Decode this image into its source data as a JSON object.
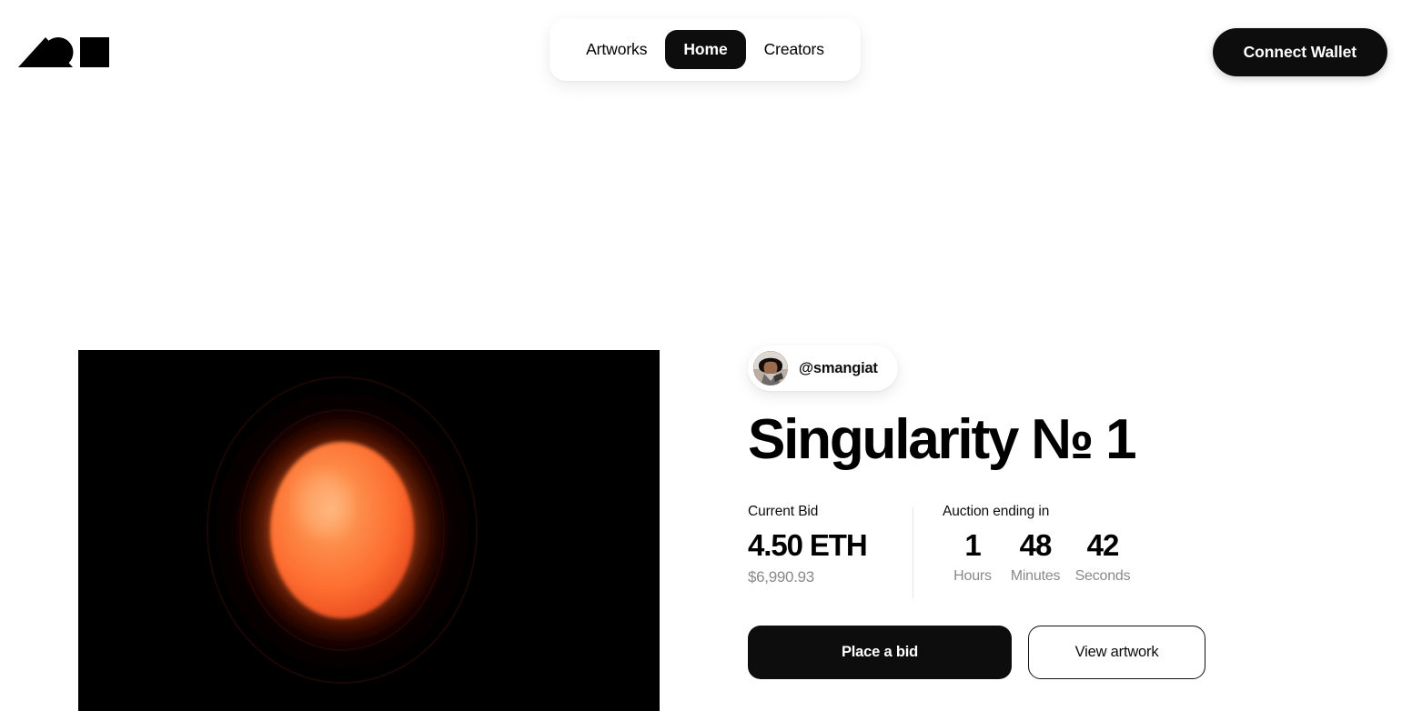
{
  "header": {
    "logo": {
      "name": "brand-logo",
      "shapes": [
        "triangle",
        "circle",
        "square"
      ],
      "color": "#000000"
    },
    "nav": {
      "items": [
        {
          "label": "Artworks",
          "active": false
        },
        {
          "label": "Home",
          "active": true
        },
        {
          "label": "Creators",
          "active": false
        }
      ]
    },
    "connect_wallet_label": "Connect Wallet"
  },
  "hero": {
    "artwork": {
      "alt": "Glowing orange sphere on black background",
      "background_color": "#000000",
      "core_color": "#ff6a33",
      "core_highlight": "#ffa05c",
      "halo_color": "#3a1109"
    },
    "artist": {
      "handle": "@smangiat",
      "avatar_name": "artist-avatar"
    },
    "title": "Singularity № 1",
    "bid": {
      "label": "Current Bid",
      "amount": "4.50 ETH",
      "usd": "$6,990.93"
    },
    "auction": {
      "label": "Auction ending in",
      "units": [
        {
          "value": "1",
          "unit": "Hours"
        },
        {
          "value": "48",
          "unit": "Minutes"
        },
        {
          "value": "42",
          "unit": "Seconds"
        }
      ]
    },
    "actions": {
      "primary_label": "Place a bid",
      "secondary_label": "View artwork"
    }
  },
  "colors": {
    "page_background": "#ffffff",
    "ink": "#0d0d0d",
    "muted": "#8a8a8a",
    "divider": "#e6e6e6"
  }
}
